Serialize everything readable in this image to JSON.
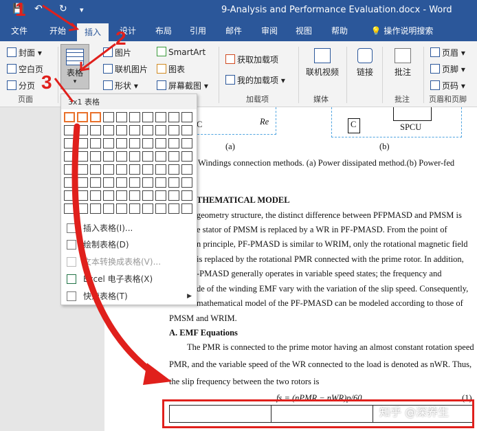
{
  "window": {
    "title": "9-Analysis and Performance Evaluation.docx  -  Word"
  },
  "quick_access": {
    "save": "💾",
    "undo": "↶",
    "redo": "↻",
    "more": "▾"
  },
  "tabs": [
    "文件",
    "开始",
    "插入",
    "设计",
    "布局",
    "引用",
    "邮件",
    "审阅",
    "视图",
    "帮助",
    "操作说明搜索"
  ],
  "active_tab": "插入",
  "ribbon": {
    "pages": {
      "cover": "封面",
      "blank": "空白页",
      "break": "分页",
      "group": "页面"
    },
    "table": {
      "label": "表格"
    },
    "illustrations": {
      "pictures": "图片",
      "online_pictures": "联机图片",
      "shapes": "形状",
      "smartart": "SmartArt",
      "chart": "图表",
      "screenshot": "屏幕截图"
    },
    "addins": {
      "get": "获取加载项",
      "mine": "我的加载项",
      "group": "加载项"
    },
    "media": {
      "online_video": "联机视频",
      "group": "媒体"
    },
    "link": {
      "label": "链接"
    },
    "comment": {
      "label": "批注",
      "group": "批注"
    },
    "header_footer": {
      "header": "页眉",
      "footer": "页脚",
      "page_number": "页码",
      "group": "页眉和页脚"
    }
  },
  "table_dropdown": {
    "header": "3x1 表格",
    "rows": 8,
    "cols": 10,
    "selected_cols": 3,
    "selected_rows": 1,
    "items": [
      {
        "label": "插入表格(I)...",
        "disabled": false
      },
      {
        "label": "绘制表格(D)",
        "disabled": false
      },
      {
        "label": "文本转换成表格(V)...",
        "disabled": true
      },
      {
        "label": "Excel 电子表格(X)",
        "disabled": false
      },
      {
        "label": "快速表格(T)",
        "disabled": false
      }
    ]
  },
  "document": {
    "fig_labels": {
      "a": "(a)",
      "b": "(b)",
      "c1": "C",
      "re": "Re",
      "c2": "C",
      "spcu": "SPCU"
    },
    "lines": [
      "Windings connection methods. (a) Power dissipated method.(b) Power-fed",
      "THEMATICAL MODEL",
      "geometry structure, the distinct difference between PFPMASD and PMSM is",
      "e stator of PMSM is replaced by a WR in PF-PMASD. From the point of",
      "n principle, PF-PMASD is similar to WRIM, only the rotational magnetic field",
      "is replaced by the rotational PMR connected with the prime rotor. In addition,",
      "-PMASD generally operates in variable speed states; the frequency and",
      "de of the winding EMF vary with the variation of the slip speed. Consequently,",
      "mathematical model of the PF-PMASD can be modeled according to those of",
      "PMSM and WRIM.",
      "A.  EMF Equations",
      "The PMR is connected to the prime motor having an almost constant rotation speed",
      "PMR, and the variable speed of the WR connected to the load is denoted as  nWR. Thus,",
      "the slip frequency between the two rotors is"
    ],
    "equation": "fs = (nPMR − nWR)p/60",
    "equation_number": "(1)"
  },
  "annotations": {
    "step1": "1",
    "step2": "2",
    "step3": "3"
  },
  "watermark": "知乎 @深养生"
}
